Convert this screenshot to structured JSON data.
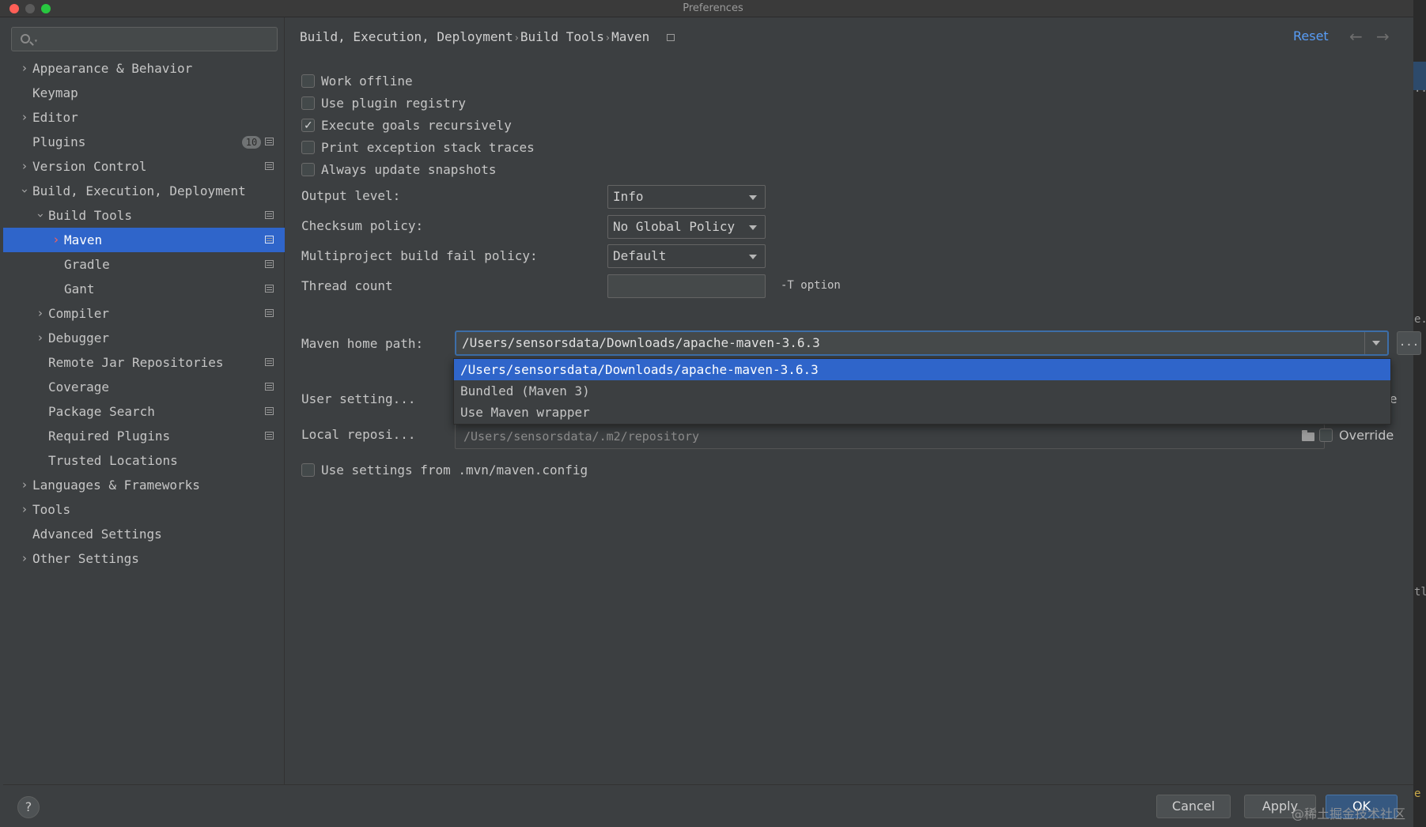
{
  "window": {
    "title": "Preferences"
  },
  "sidebar": {
    "search": {
      "placeholder": ""
    },
    "items": [
      {
        "label": "Appearance & Behavior"
      },
      {
        "label": "Keymap"
      },
      {
        "label": "Editor"
      },
      {
        "label": "Plugins",
        "badge": "10"
      },
      {
        "label": "Version Control"
      },
      {
        "label": "Build, Execution, Deployment"
      },
      {
        "label": "Build Tools"
      },
      {
        "label": "Maven"
      },
      {
        "label": "Gradle"
      },
      {
        "label": "Gant"
      },
      {
        "label": "Compiler"
      },
      {
        "label": "Debugger"
      },
      {
        "label": "Remote Jar Repositories"
      },
      {
        "label": "Coverage"
      },
      {
        "label": "Package Search"
      },
      {
        "label": "Required Plugins"
      },
      {
        "label": "Trusted Locations"
      },
      {
        "label": "Languages & Frameworks"
      },
      {
        "label": "Tools"
      },
      {
        "label": "Advanced Settings"
      },
      {
        "label": "Other Settings"
      }
    ]
  },
  "header": {
    "breadcrumb": [
      "Build, Execution, Deployment",
      "Build Tools",
      "Maven"
    ],
    "reset_label": "Reset"
  },
  "options": {
    "checkboxes": [
      {
        "label": "Work offline",
        "checked": false
      },
      {
        "label": "Use plugin registry",
        "checked": false
      },
      {
        "label": "Execute goals recursively",
        "checked": true
      },
      {
        "label": "Print exception stack traces",
        "checked": false
      },
      {
        "label": "Always update snapshots",
        "checked": false
      }
    ],
    "output_level": {
      "label": "Output level:",
      "value": "Info"
    },
    "checksum_policy": {
      "label": "Checksum policy:",
      "value": "No Global Policy"
    },
    "fail_policy": {
      "label": "Multiproject build fail policy:",
      "value": "Default"
    },
    "thread_count": {
      "label": "Thread count",
      "value": "",
      "hint": "-T option"
    },
    "maven_home": {
      "label": "Maven home path:",
      "value": "/Users/sensorsdata/Downloads/apache-maven-3.6.3",
      "browse_label": "...",
      "dropdown_options": [
        "/Users/sensorsdata/Downloads/apache-maven-3.6.3",
        "Bundled (Maven 3)",
        "Use Maven wrapper"
      ]
    },
    "user_settings": {
      "label": "User setting...",
      "override_partial": "ride"
    },
    "local_repo": {
      "label": "Local reposi...",
      "value": "/Users/sensorsdata/.m2/repository",
      "override_label": "Override"
    },
    "mvn_config": {
      "label": "Use settings from .mvn/maven.config",
      "checked": false
    }
  },
  "footer": {
    "help_label": "?",
    "cancel_label": "Cancel",
    "apply_label": "Apply",
    "ok_label": "OK",
    "watermark": "@稀土掘金技术社区"
  },
  "background_window": {
    "fragments": [
      "..a",
      "e.",
      "tl",
      "e"
    ]
  },
  "colors": {
    "background": "#3c3f41",
    "selection": "#2f65ca",
    "link": "#589df6",
    "text": "#bbbbbb"
  }
}
